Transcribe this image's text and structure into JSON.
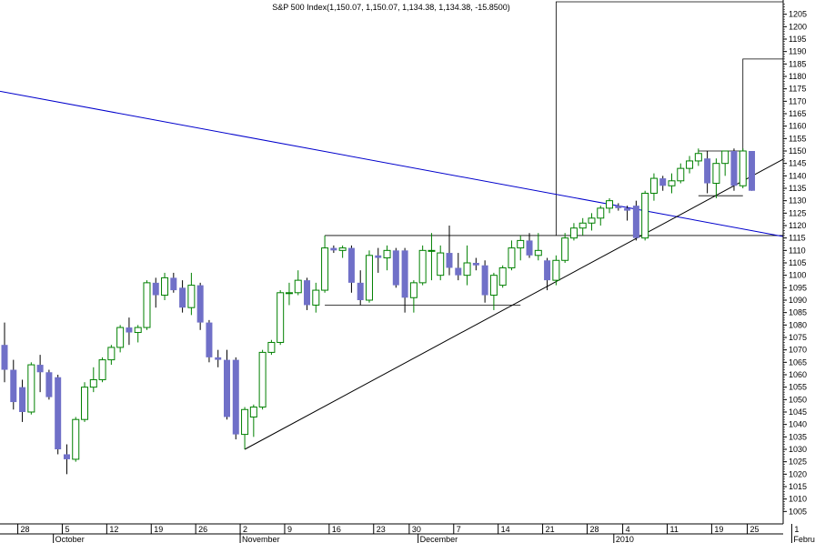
{
  "chart_data": {
    "type": "candlestick",
    "title": "S&P 500 Index",
    "title_values": "(1,150.07, 1,150.07, 1,134.38, 1,134.38, -15.8500)",
    "ylim": [
      1000,
      1210
    ],
    "y_ticks": [
      1005,
      1010,
      1015,
      1020,
      1025,
      1030,
      1035,
      1040,
      1045,
      1050,
      1055,
      1060,
      1065,
      1070,
      1075,
      1080,
      1085,
      1090,
      1095,
      1100,
      1105,
      1110,
      1115,
      1120,
      1125,
      1130,
      1135,
      1140,
      1145,
      1150,
      1155,
      1160,
      1165,
      1170,
      1175,
      1180,
      1185,
      1190,
      1195,
      1200,
      1205
    ],
    "x_day_ticks": [
      {
        "label": "28",
        "idx": 2
      },
      {
        "label": "5",
        "idx": 7
      },
      {
        "label": "12",
        "idx": 12
      },
      {
        "label": "19",
        "idx": 17
      },
      {
        "label": "26",
        "idx": 22
      },
      {
        "label": "2",
        "idx": 27
      },
      {
        "label": "9",
        "idx": 32
      },
      {
        "label": "16",
        "idx": 37
      },
      {
        "label": "23",
        "idx": 42
      },
      {
        "label": "30",
        "idx": 46
      },
      {
        "label": "7",
        "idx": 51
      },
      {
        "label": "14",
        "idx": 56
      },
      {
        "label": "21",
        "idx": 61
      },
      {
        "label": "28",
        "idx": 66
      },
      {
        "label": "4",
        "idx": 70
      },
      {
        "label": "11",
        "idx": 75
      },
      {
        "label": "19",
        "idx": 80
      },
      {
        "label": "25",
        "idx": 84
      },
      {
        "label": "1",
        "idx": 89
      }
    ],
    "x_month_labels": [
      {
        "label": "October",
        "idx": 6
      },
      {
        "label": "November",
        "idx": 27
      },
      {
        "label": "December",
        "idx": 47
      },
      {
        "label": "2010",
        "idx": 69
      },
      {
        "label": "Februar",
        "idx": 89
      }
    ],
    "candles": [
      {
        "o": 1072,
        "h": 1081,
        "l": 1057,
        "c": 1062
      },
      {
        "o": 1062,
        "h": 1066,
        "l": 1046,
        "c": 1049
      },
      {
        "o": 1055,
        "h": 1058,
        "l": 1041,
        "c": 1045
      },
      {
        "o": 1045,
        "h": 1065,
        "l": 1044,
        "c": 1064
      },
      {
        "o": 1064,
        "h": 1068,
        "l": 1053,
        "c": 1061
      },
      {
        "o": 1061,
        "h": 1062,
        "l": 1050,
        "c": 1051
      },
      {
        "o": 1059,
        "h": 1060,
        "l": 1028,
        "c": 1030
      },
      {
        "o": 1028,
        "h": 1032,
        "l": 1020,
        "c": 1026
      },
      {
        "o": 1026,
        "h": 1043,
        "l": 1025,
        "c": 1042
      },
      {
        "o": 1042,
        "h": 1057,
        "l": 1041,
        "c": 1055
      },
      {
        "o": 1055,
        "h": 1063,
        "l": 1053,
        "c": 1058
      },
      {
        "o": 1058,
        "h": 1067,
        "l": 1057,
        "c": 1066
      },
      {
        "o": 1066,
        "h": 1072,
        "l": 1064,
        "c": 1071
      },
      {
        "o": 1071,
        "h": 1080,
        "l": 1069,
        "c": 1079
      },
      {
        "o": 1079,
        "h": 1083,
        "l": 1072,
        "c": 1077
      },
      {
        "o": 1077,
        "h": 1080,
        "l": 1073,
        "c": 1079
      },
      {
        "o": 1079,
        "h": 1098,
        "l": 1078,
        "c": 1097
      },
      {
        "o": 1097,
        "h": 1099,
        "l": 1087,
        "c": 1092
      },
      {
        "o": 1092,
        "h": 1101,
        "l": 1090,
        "c": 1099
      },
      {
        "o": 1099,
        "h": 1101,
        "l": 1093,
        "c": 1094
      },
      {
        "o": 1095,
        "h": 1098,
        "l": 1085,
        "c": 1087
      },
      {
        "o": 1087,
        "h": 1101,
        "l": 1084,
        "c": 1096
      },
      {
        "o": 1096,
        "h": 1097,
        "l": 1078,
        "c": 1081
      },
      {
        "o": 1081,
        "h": 1082,
        "l": 1065,
        "c": 1067
      },
      {
        "o": 1067,
        "h": 1070,
        "l": 1063,
        "c": 1066
      },
      {
        "o": 1066,
        "h": 1070,
        "l": 1042,
        "c": 1043
      },
      {
        "o": 1066,
        "h": 1067,
        "l": 1034,
        "c": 1036
      },
      {
        "o": 1036,
        "h": 1047,
        "l": 1030,
        "c": 1046
      },
      {
        "o": 1043,
        "h": 1048,
        "l": 1035,
        "c": 1047
      },
      {
        "o": 1047,
        "h": 1070,
        "l": 1046,
        "c": 1069
      },
      {
        "o": 1069,
        "h": 1074,
        "l": 1068,
        "c": 1073
      },
      {
        "o": 1073,
        "h": 1094,
        "l": 1072,
        "c": 1093
      },
      {
        "o": 1093,
        "h": 1097,
        "l": 1088,
        "c": 1093
      },
      {
        "o": 1093,
        "h": 1102,
        "l": 1092,
        "c": 1098
      },
      {
        "o": 1098,
        "h": 1099,
        "l": 1086,
        "c": 1088
      },
      {
        "o": 1088,
        "h": 1097,
        "l": 1085,
        "c": 1094
      },
      {
        "o": 1094,
        "h": 1116,
        "l": 1093,
        "c": 1111
      },
      {
        "o": 1111,
        "h": 1112,
        "l": 1109,
        "c": 1110
      },
      {
        "o": 1110,
        "h": 1112,
        "l": 1107,
        "c": 1111
      },
      {
        "o": 1111,
        "h": 1112,
        "l": 1093,
        "c": 1097
      },
      {
        "o": 1097,
        "h": 1102,
        "l": 1088,
        "c": 1090
      },
      {
        "o": 1090,
        "h": 1110,
        "l": 1089,
        "c": 1108
      },
      {
        "o": 1108,
        "h": 1111,
        "l": 1101,
        "c": 1107
      },
      {
        "o": 1107,
        "h": 1112,
        "l": 1102,
        "c": 1110
      },
      {
        "o": 1110,
        "h": 1111,
        "l": 1095,
        "c": 1096
      },
      {
        "o": 1110,
        "h": 1111,
        "l": 1085,
        "c": 1091
      },
      {
        "o": 1091,
        "h": 1098,
        "l": 1085,
        "c": 1097
      },
      {
        "o": 1097,
        "h": 1112,
        "l": 1096,
        "c": 1110
      },
      {
        "o": 1110,
        "h": 1117,
        "l": 1098,
        "c": 1110
      },
      {
        "o": 1100,
        "h": 1112,
        "l": 1098,
        "c": 1109
      },
      {
        "o": 1109,
        "h": 1120,
        "l": 1100,
        "c": 1103
      },
      {
        "o": 1103,
        "h": 1109,
        "l": 1098,
        "c": 1100
      },
      {
        "o": 1100,
        "h": 1112,
        "l": 1096,
        "c": 1105
      },
      {
        "o": 1105,
        "h": 1107,
        "l": 1102,
        "c": 1104
      },
      {
        "o": 1104,
        "h": 1106,
        "l": 1089,
        "c": 1092
      },
      {
        "o": 1092,
        "h": 1101,
        "l": 1086,
        "c": 1100
      },
      {
        "o": 1096,
        "h": 1104,
        "l": 1095,
        "c": 1103
      },
      {
        "o": 1103,
        "h": 1114,
        "l": 1102,
        "c": 1111
      },
      {
        "o": 1111,
        "h": 1116,
        "l": 1106,
        "c": 1114
      },
      {
        "o": 1114,
        "h": 1117,
        "l": 1107,
        "c": 1108
      },
      {
        "o": 1108,
        "h": 1117,
        "l": 1106,
        "c": 1110
      },
      {
        "o": 1106,
        "h": 1107,
        "l": 1094,
        "c": 1098
      },
      {
        "o": 1098,
        "h": 1108,
        "l": 1096,
        "c": 1106
      },
      {
        "o": 1106,
        "h": 1117,
        "l": 1105,
        "c": 1115
      },
      {
        "o": 1115,
        "h": 1121,
        "l": 1114,
        "c": 1119
      },
      {
        "o": 1119,
        "h": 1123,
        "l": 1116,
        "c": 1121
      },
      {
        "o": 1121,
        "h": 1125,
        "l": 1118,
        "c": 1123
      },
      {
        "o": 1123,
        "h": 1128,
        "l": 1120,
        "c": 1127
      },
      {
        "o": 1127,
        "h": 1131,
        "l": 1125,
        "c": 1130
      },
      {
        "o": 1128,
        "h": 1129,
        "l": 1126,
        "c": 1127
      },
      {
        "o": 1127,
        "h": 1128,
        "l": 1122,
        "c": 1126
      },
      {
        "o": 1128,
        "h": 1130,
        "l": 1114,
        "c": 1115
      },
      {
        "o": 1115,
        "h": 1134,
        "l": 1114,
        "c": 1133
      },
      {
        "o": 1133,
        "h": 1141,
        "l": 1130,
        "c": 1139
      },
      {
        "o": 1139,
        "h": 1140,
        "l": 1134,
        "c": 1136
      },
      {
        "o": 1136,
        "h": 1141,
        "l": 1133,
        "c": 1138
      },
      {
        "o": 1138,
        "h": 1145,
        "l": 1137,
        "c": 1143
      },
      {
        "o": 1143,
        "h": 1148,
        "l": 1141,
        "c": 1146
      },
      {
        "o": 1146,
        "h": 1151,
        "l": 1144,
        "c": 1149
      },
      {
        "o": 1147,
        "h": 1150,
        "l": 1133,
        "c": 1137
      },
      {
        "o": 1137,
        "h": 1147,
        "l": 1131,
        "c": 1145
      },
      {
        "o": 1145,
        "h": 1150,
        "l": 1140,
        "c": 1150
      },
      {
        "o": 1150,
        "h": 1151,
        "l": 1134,
        "c": 1136
      },
      {
        "o": 1136,
        "h": 1151,
        "l": 1135,
        "c": 1150
      },
      {
        "o": 1150,
        "h": 1150,
        "l": 1134,
        "c": 1134
      }
    ],
    "trendlines": [
      {
        "name": "",
        "color": "#0000cc",
        "points": [
          [
            -5,
            1177
          ],
          [
            96,
            1110
          ]
        ]
      },
      {
        "name": "",
        "color": "#000000",
        "points": [
          [
            27,
            1030
          ],
          [
            96,
            1163
          ]
        ]
      }
    ],
    "horizontal_lines": [
      {
        "value": 1116,
        "from_idx": 36,
        "to_idx": 96,
        "color": "#000000"
      },
      {
        "value": 1088,
        "from_idx": 36,
        "to_idx": 58,
        "color": "#000000"
      },
      {
        "value": 1150,
        "from_idx": 78,
        "to_idx": 83,
        "color": "#000000"
      },
      {
        "value": 1132,
        "from_idx": 78,
        "to_idx": 83,
        "color": "#000000"
      }
    ],
    "boxes": [
      {
        "from_idx": 62,
        "to_idx": 96,
        "top": 1210,
        "bottom": 1116,
        "color": "#000000"
      },
      {
        "from_idx": 83,
        "to_idx": 96,
        "top": 1187,
        "bottom": 1150,
        "color": "#000000"
      }
    ],
    "colors": {
      "up": "#008000",
      "down_body": "#7070c8",
      "down_wick": "#000000",
      "up_fill": "#ffffff",
      "axis": "#000000"
    }
  }
}
